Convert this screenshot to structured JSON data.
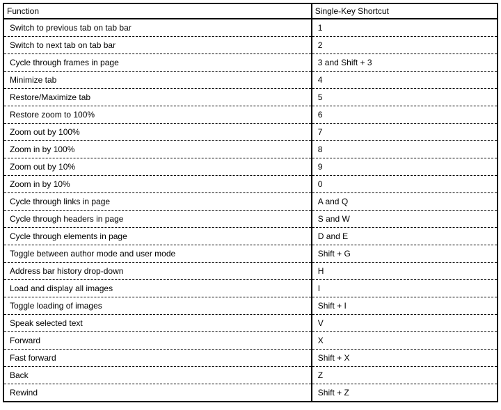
{
  "headers": {
    "function": "Function",
    "shortcut": "Single-Key Shortcut"
  },
  "rows": [
    {
      "fn": "Switch to previous tab on tab bar",
      "sc": "1"
    },
    {
      "fn": "Switch to next tab on tab bar",
      "sc": "2"
    },
    {
      "fn": "Cycle through frames in page",
      "sc": "3 and Shift + 3"
    },
    {
      "fn": "Minimize tab",
      "sc": "4"
    },
    {
      "fn": "Restore/Maximize tab",
      "sc": "5"
    },
    {
      "fn": "Restore zoom to 100%",
      "sc": "6"
    },
    {
      "fn": "Zoom out by 100%",
      "sc": "7"
    },
    {
      "fn": "Zoom in by 100%",
      "sc": "8"
    },
    {
      "fn": "Zoom out by 10%",
      "sc": "9"
    },
    {
      "fn": "Zoom in by 10%",
      "sc": "0"
    },
    {
      "fn": "Cycle through links in page",
      "sc": "A and Q"
    },
    {
      "fn": "Cycle through headers in page",
      "sc": "S and W"
    },
    {
      "fn": "Cycle through elements in page",
      "sc": "D and E"
    },
    {
      "fn": "Toggle between author mode and user mode",
      "sc": "Shift + G"
    },
    {
      "fn": "Address bar history drop-down",
      "sc": "H"
    },
    {
      "fn": "Load and display all images",
      "sc": "I"
    },
    {
      "fn": "Toggle loading of images",
      "sc": "Shift + I"
    },
    {
      "fn": "Speak selected text",
      "sc": "V"
    },
    {
      "fn": "Forward",
      "sc": "X"
    },
    {
      "fn": "Fast forward",
      "sc": "Shift + X"
    },
    {
      "fn": "Back",
      "sc": "Z"
    },
    {
      "fn": "Rewind",
      "sc": "Shift + Z"
    }
  ]
}
